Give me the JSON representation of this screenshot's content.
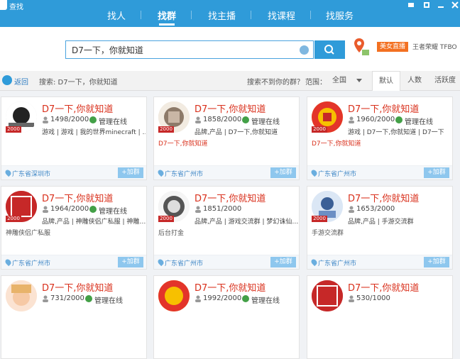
{
  "app": {
    "title": "查找"
  },
  "nav": {
    "tabs": [
      {
        "label": "找人"
      },
      {
        "label": "找群"
      },
      {
        "label": "找主播"
      },
      {
        "label": "找课程"
      },
      {
        "label": "找服务"
      }
    ],
    "active_tab": 1
  },
  "search": {
    "value": "D7一下，你就知道"
  },
  "promo": {
    "badge": "美女直播",
    "text": "王者荣耀  TFBO"
  },
  "filter": {
    "back_label": "返回",
    "summary": "搜索: D7一下，你就知道",
    "not_found": "搜索不到你的群？",
    "range_label": "范围：",
    "range_value": "全国",
    "sort_tabs": [
      "默认",
      "人数",
      "活跃度"
    ]
  },
  "cards": [
    {
      "title": "D7一下,你就知道",
      "members": "1498/2000",
      "admin": "管理在线",
      "tags": "游戏 | 游戏 | 我的世界minecraft | …",
      "desc": "",
      "location": "广东省深圳市",
      "join": "+加群",
      "badge": "2000"
    },
    {
      "title": "D7一下,你就知道",
      "members": "1858/2000",
      "admin": "管理在线",
      "tags": "品牌,产品 | D7一下,你就知道",
      "desc": "D7一下,你就知道",
      "location": "广东省广州市",
      "join": "+加群",
      "badge": "2000"
    },
    {
      "title": "D7一下,你就知道",
      "members": "1960/2000",
      "admin": "管理在线",
      "tags": "游戏 | D7一下,你就知道 | D7一下",
      "desc": "D7一下,你就知道",
      "location": "广东省广州市",
      "join": "+加群",
      "badge": "2000"
    },
    {
      "title": "D7一下,你就知道",
      "members": "1964/2000",
      "admin": "管理在线",
      "tags": "品牌,产品 | 神雕侠侣广私服 | 神雕…",
      "desc": "神雕侠侣广私服",
      "location": "广东省广州市",
      "join": "+加群",
      "badge": "2000"
    },
    {
      "title": "D7一下,你就知道",
      "members": "1851/2000",
      "admin": "",
      "tags": "品牌,产品 | 游戏交流群 | 梦幻诛仙…",
      "desc": "后台打金",
      "location": "广东省广州市",
      "join": "+加群",
      "badge": "2000"
    },
    {
      "title": "D7一下,你就知道",
      "members": "1653/2000",
      "admin": "",
      "tags": "品牌,产品 | 手游交流群",
      "desc": "手游交流群",
      "location": "广东省广州市",
      "join": "+加群",
      "badge": "2000"
    },
    {
      "title": "D7一下,你就知道",
      "members": "731/2000",
      "admin": "管理在线",
      "tags": "",
      "desc": "",
      "location": "",
      "join": "",
      "badge": ""
    },
    {
      "title": "D7一下,你就知道",
      "members": "1992/2000",
      "admin": "管理在线",
      "tags": "",
      "desc": "",
      "location": "",
      "join": "",
      "badge": ""
    },
    {
      "title": "D7一下,你就知道",
      "members": "530/1000",
      "admin": "",
      "tags": "",
      "desc": "",
      "location": "",
      "join": "",
      "badge": ""
    }
  ],
  "colors": {
    "primary": "#2f9bd9",
    "title_red": "#d9301c",
    "badge_orange": "#f37021"
  }
}
